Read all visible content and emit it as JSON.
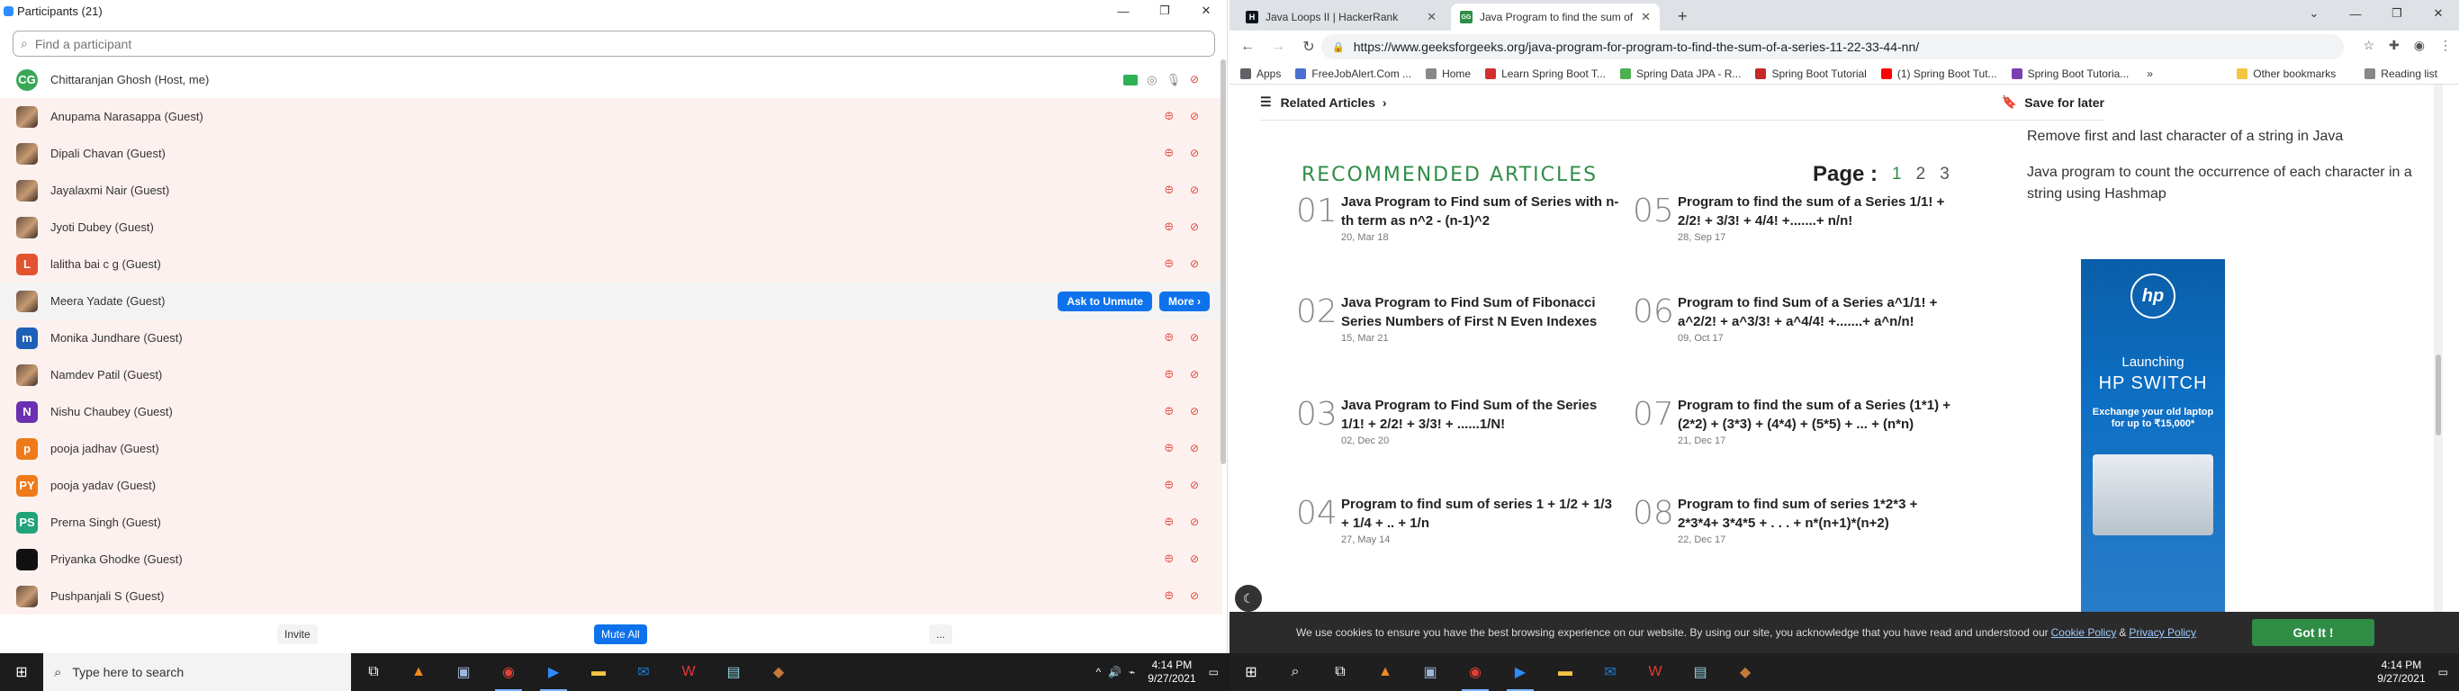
{
  "zoom": {
    "title": "Participants (21)",
    "search_placeholder": "Find a participant",
    "participants": [
      {
        "name": "Chittaranjan Ghosh (Host, me)",
        "initials": "CG",
        "color": "#3aa757",
        "kind": "host"
      },
      {
        "name": "Anupama Narasappa (Guest)",
        "initials": "",
        "color": "",
        "kind": "photo"
      },
      {
        "name": "Dipali Chavan (Guest)",
        "initials": "",
        "color": "",
        "kind": "photo"
      },
      {
        "name": "Jayalaxmi Nair (Guest)",
        "initials": "",
        "color": "",
        "kind": "photo"
      },
      {
        "name": "Jyoti Dubey (Guest)",
        "initials": "",
        "color": "",
        "kind": "photo"
      },
      {
        "name": "lalitha bai c g (Guest)",
        "initials": "L",
        "color": "#e2532e",
        "kind": "initial"
      },
      {
        "name": "Meera Yadate (Guest)",
        "initials": "",
        "color": "",
        "kind": "photo-hover"
      },
      {
        "name": "Monika Jundhare (Guest)",
        "initials": "m",
        "color": "#1e5fb8",
        "kind": "initial"
      },
      {
        "name": "Namdev Patil (Guest)",
        "initials": "",
        "color": "",
        "kind": "photo"
      },
      {
        "name": "Nishu Chaubey (Guest)",
        "initials": "N",
        "color": "#6b2fb3",
        "kind": "initial"
      },
      {
        "name": "pooja jadhav (Guest)",
        "initials": "p",
        "color": "#ee7a1a",
        "kind": "initial"
      },
      {
        "name": "pooja yadav (Guest)",
        "initials": "PY",
        "color": "#ee7a1a",
        "kind": "initial"
      },
      {
        "name": "Prerna Singh (Guest)",
        "initials": "PS",
        "color": "#21a37a",
        "kind": "initial"
      },
      {
        "name": "Priyanka Ghodke (Guest)",
        "initials": "",
        "color": "#111",
        "kind": "initial"
      },
      {
        "name": "Pushpanjali S (Guest)",
        "initials": "",
        "color": "",
        "kind": "photo"
      }
    ],
    "ask_unmute_label": "Ask to Unmute",
    "more_label": "More ›",
    "invite_label": "Invite",
    "mute_all_label": "Mute All",
    "more_footer_label": "..."
  },
  "chrome": {
    "tabs": [
      {
        "title": "Java Loops II | HackerRank",
        "fav": "H",
        "fav_color": "#1ba94c"
      },
      {
        "title": "Java Program to find the sum of",
        "fav": "GG",
        "fav_color": "#2f8d46"
      }
    ],
    "url": "https://www.geeksforgeeks.org/java-program-for-program-to-find-the-sum-of-a-series-11-22-33-44-nn/",
    "bookmarks": [
      {
        "label": "Apps",
        "color": "#5f6368"
      },
      {
        "label": "FreeJobAlert.Com ...",
        "color": "#4a6fd1"
      },
      {
        "label": "Home",
        "color": "#888"
      },
      {
        "label": "Learn Spring Boot T...",
        "color": "#d32f2f"
      },
      {
        "label": "Spring Data JPA - R...",
        "color": "#4caf50"
      },
      {
        "label": "Spring Boot Tutorial",
        "color": "#c62828"
      },
      {
        "label": "(1) Spring Boot Tut...",
        "color": "#ff0000"
      },
      {
        "label": "Spring Boot Tutoria...",
        "color": "#7b3fb0"
      }
    ],
    "other_bookmarks": "Other bookmarks",
    "reading_list": "Reading list"
  },
  "gfg": {
    "related_articles": "Related Articles",
    "save_for_later": "Save for later",
    "recommended": "RECOMMENDED ARTICLES",
    "page_label": "Page :",
    "pages": [
      "1",
      "2",
      "3"
    ],
    "articles": [
      {
        "num": "01",
        "title": "Java Program to Find sum of Series with n-th term as n^2 - (n-1)^2",
        "date": "20, Mar 18"
      },
      {
        "num": "02",
        "title": "Java Program to Find Sum of Fibonacci Series Numbers of First N Even Indexes",
        "date": "15, Mar 21"
      },
      {
        "num": "03",
        "title": "Java Program to Find Sum of the Series 1/1! + 2/2! + 3/3! + ......1/N!",
        "date": "02, Dec 20"
      },
      {
        "num": "04",
        "title": "Program to find sum of series 1 + 1/2 + 1/3 + 1/4 + .. + 1/n",
        "date": "27, May 14"
      },
      {
        "num": "05",
        "title": "Program to find the sum of a Series 1/1! + 2/2! + 3/3! + 4/4! +.......+ n/n!",
        "date": "28, Sep 17"
      },
      {
        "num": "06",
        "title": "Program to find Sum of a Series a^1/1! + a^2/2! + a^3/3! + a^4/4! +.......+ a^n/n!",
        "date": "09, Oct 17"
      },
      {
        "num": "07",
        "title": "Program to find the sum of a Series (1*1) + (2*2) + (3*3) + (4*4) + (5*5) + ... + (n*n)",
        "date": "21, Dec 17"
      },
      {
        "num": "08",
        "title": "Program to find sum of series 1*2*3 + 2*3*4+ 3*4*5 + . . . + n*(n+1)*(n+2)",
        "date": "22, Dec 17"
      }
    ],
    "side_links": [
      "Remove first and last character of a string in Java",
      "Java program to count the occurrence of each character in a string using Hashmap"
    ],
    "ad": {
      "logo": "hp",
      "line1": "Launching",
      "line2": "HP SWITCH",
      "line3": "Exchange your old laptop for up to ₹15,000*"
    },
    "cookie_text": "We use cookies to ensure you have the best browsing experience on our website. By using our site, you acknowledge that you have read and understood our",
    "cookie_policy": "Cookie Policy",
    "amp": "&",
    "privacy_policy": "Privacy Policy",
    "got_it": "Got It !"
  },
  "taskbar": {
    "search_placeholder": "Type here to search",
    "time": "4:14 PM",
    "date": "9/27/2021"
  }
}
